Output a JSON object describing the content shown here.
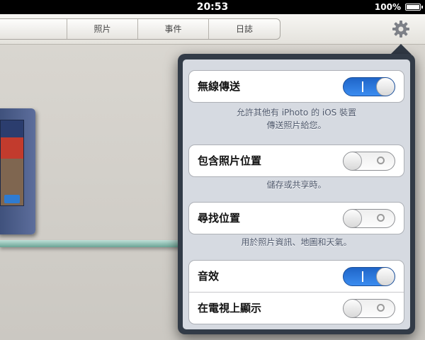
{
  "status_bar": {
    "time": "20:53",
    "battery": "100%"
  },
  "toolbar": {
    "segments": [
      "照片",
      "事件",
      "日誌"
    ],
    "gear_icon": "gear-icon"
  },
  "settings": {
    "wireless": {
      "label": "無線傳送",
      "state": "on",
      "footer_line1": "允許其他有 iPhoto 的 iOS 裝置",
      "footer_line2": "傳送照片給您。"
    },
    "include_location": {
      "label": "包含照片位置",
      "state": "off",
      "footer": "儲存或共享時。"
    },
    "find_location": {
      "label": "尋找位置",
      "state": "off",
      "footer": "用於照片資訊、地圖和天氣。"
    },
    "sound": {
      "label": "音效",
      "state": "on"
    },
    "show_on_tv": {
      "label": "在電視上顯示",
      "state": "off"
    }
  },
  "colors": {
    "switch_on": "#2d78e0",
    "popover_border": "#323b47",
    "popover_bg": "#d6dae1"
  }
}
